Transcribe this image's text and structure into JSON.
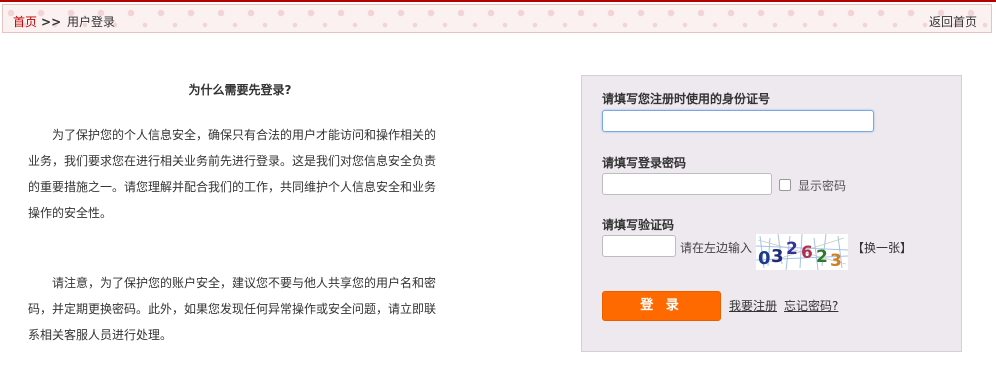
{
  "breadcrumb": {
    "home": "首页",
    "separator": ">>",
    "current": "用户登录",
    "back_home": "返回首页"
  },
  "intro": {
    "title": "为什么需要先登录?",
    "paragraph1": "为了保护您的个人信息安全，确保只有合法的用户才能访问和操作相关的业务，我们要求您在进行相关业务前先进行登录。这是我们对您信息安全负责的重要措施之一。请您理解并配合我们的工作，共同维护个人信息安全和业务操作的安全性。",
    "paragraph2": "请注意，为了保护您的账户安全，建议您不要与他人共享您的用户名和密码，并定期更换密码。此外，如果您发现任何异常操作或安全问题，请立即联系相关客服人员进行处理。"
  },
  "form": {
    "id_label": "请填写您注册时使用的身份证号",
    "id_value": "",
    "password_label": "请填写登录密码",
    "password_value": "",
    "show_password_label": "显示密码",
    "show_password_checked": false,
    "captcha_label": "请填写验证码",
    "captcha_value": "",
    "captcha_hint": "请在左边输入",
    "captcha_text": "032623",
    "captcha_refresh": "【换一张】",
    "login_button": "登 录",
    "register_link": "我要注册",
    "forgot_link": "忘记密码?"
  },
  "colors": {
    "accent": "#ff6a00",
    "breadcrumb_link": "#c00000",
    "panel_bg": "#eee9ef"
  }
}
